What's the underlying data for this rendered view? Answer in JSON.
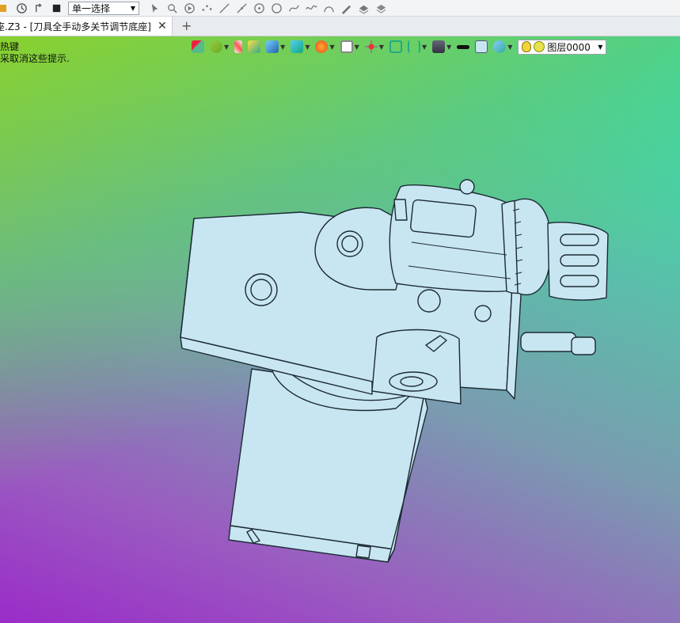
{
  "toolbar": {
    "select_mode": "单一选择",
    "icons": [
      "undo-icon",
      "redo-icon",
      "stop-icon",
      "pick-icon",
      "pick-drag-icon",
      "play-icon",
      "points-icon",
      "line-icon",
      "line2-icon",
      "circle-point-icon",
      "circle-icon",
      "curve-icon",
      "wave-icon",
      "arc-icon",
      "pen-icon",
      "layer-icon",
      "layer2-icon"
    ]
  },
  "tabs": {
    "doc_title": "座.Z3 - [刀具全手动多关节调节底座]",
    "close_label": "✕",
    "add_label": "+"
  },
  "hints": {
    "line1": "热键",
    "line2": "采取消这些提示."
  },
  "view_toolbar": {
    "layer_name": "图层0000"
  },
  "colors": {
    "model_fill": "#c8e6f2",
    "model_stroke": "#1c2a33"
  }
}
